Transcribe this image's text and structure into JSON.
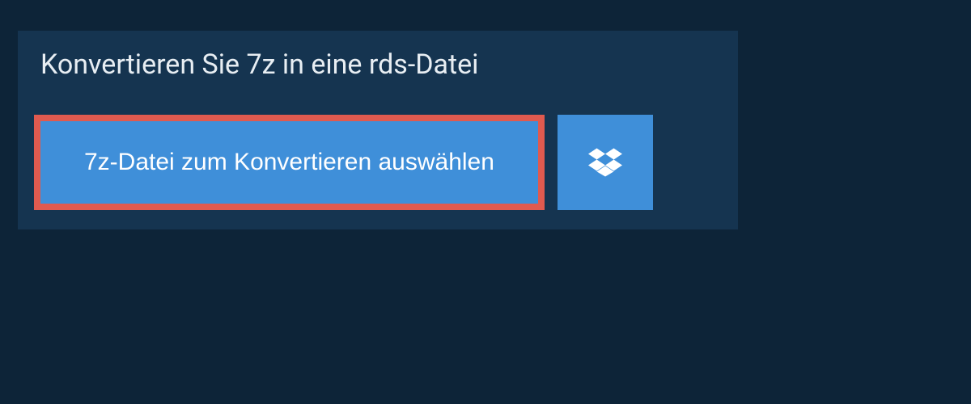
{
  "header": {
    "title": "Konvertieren Sie 7z in eine rds-Datei"
  },
  "actions": {
    "select_file_label": "7z-Datei zum Konvertieren auswählen",
    "cloud_source_icon": "dropbox-icon"
  },
  "colors": {
    "background": "#0d2438",
    "panel": "#153450",
    "button": "#3f8fd9",
    "highlight": "#e05a4f"
  }
}
